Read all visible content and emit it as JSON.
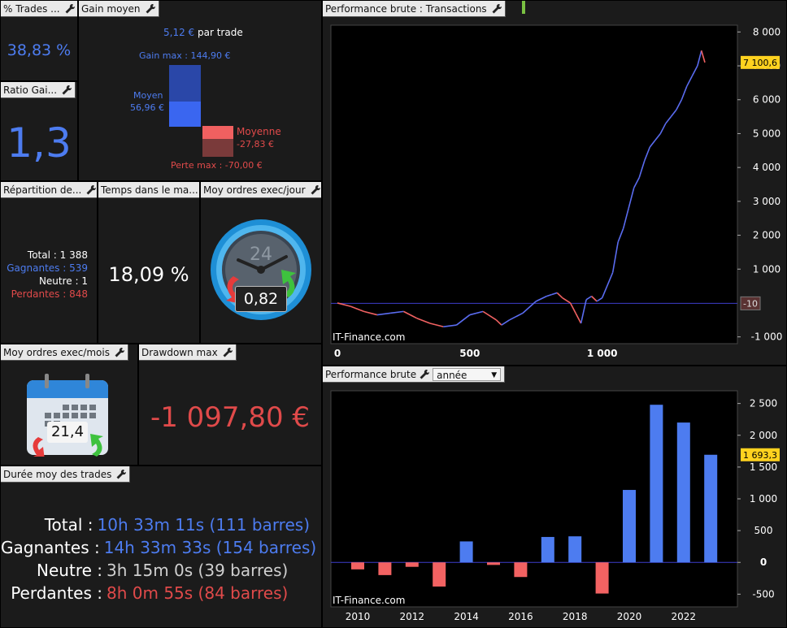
{
  "pct_trades": {
    "title": "% Trades ...",
    "value": "38,83 %"
  },
  "gain_moyen": {
    "title": "Gain moyen",
    "per_trade": "5,12 €",
    "per_trade_suffix": "par trade",
    "gain_max": "Gain max : 144,90 €",
    "moyen_label": "Moyen",
    "moyen_value": "56,96 €",
    "moyenne_label": "Moyenne",
    "moyenne_value": "-27,83 €",
    "perte_max": "Perte max : -70,00 €"
  },
  "ratio": {
    "title": "Ratio Gai...",
    "value": "1,3"
  },
  "repartition": {
    "title": "Répartition de...",
    "total_label": "Total :",
    "total_value": "1 388",
    "gagnantes_label": "Gagnantes :",
    "gagnantes_value": "539",
    "neutre_label": "Neutre :",
    "neutre_value": "1",
    "perdantes_label": "Perdantes :",
    "perdantes_value": "848"
  },
  "temps": {
    "title": "Temps dans le ma...",
    "value": "18,09 %"
  },
  "moy_jour": {
    "title": "Moy ordres exec/jour",
    "dial_number": "24",
    "value": "0,82"
  },
  "moy_mois": {
    "title": "Moy ordres exec/mois",
    "value": "21,4"
  },
  "drawdown": {
    "title": "Drawdown max",
    "value": "-1 097,80 €"
  },
  "duree": {
    "title": "Durée moy des trades",
    "rows": [
      {
        "label": "Total :",
        "value": "10h 33m 11s (111 barres)",
        "color": "#4d7cf0"
      },
      {
        "label": "Gagnantes :",
        "value": "14h 33m 33s (154 barres)",
        "color": "#4d7cf0"
      },
      {
        "label": "Neutre :",
        "value": "3h 15m 0s (39 barres)",
        "color": "#cfcfcf"
      },
      {
        "label": "Perdantes :",
        "value": "8h 0m 55s (84 barres)",
        "color": "#e04a4a"
      }
    ]
  },
  "perf_trans": {
    "title": "Performance brute : Transactions",
    "watermark": "IT-Finance.com",
    "last_value_label": "7 100,6",
    "zero_line_label": "-10"
  },
  "perf_annee": {
    "title": "Performance brute",
    "dropdown": "année",
    "watermark": "IT-Finance.com",
    "last_value_label": "1 693,3"
  },
  "colors": {
    "blue": "#4d7cf0",
    "red": "#f26262",
    "bg": "#1b1b1b",
    "title_bg": "#e9e9e9",
    "highlight": "#ffd21f"
  },
  "chart_data": [
    {
      "type": "line",
      "title": "Performance brute : Transactions",
      "x_ticks": [
        "0",
        "500",
        "1 000"
      ],
      "y_ticks": [
        "8 000",
        "7 000",
        "6 000",
        "5 000",
        "4 000",
        "3 000",
        "2 000",
        "1 000",
        "-1 000"
      ],
      "xlim": [
        0,
        1388
      ],
      "ylim": [
        -1200,
        8200
      ],
      "x": [
        0,
        50,
        100,
        150,
        200,
        250,
        300,
        350,
        400,
        450,
        500,
        550,
        600,
        620,
        650,
        700,
        750,
        790,
        810,
        830,
        850,
        880,
        900,
        920,
        940,
        960,
        980,
        1000,
        1040,
        1060,
        1080,
        1100,
        1120,
        1140,
        1160,
        1180,
        1200,
        1220,
        1240,
        1260,
        1280,
        1300,
        1320,
        1340,
        1360,
        1375,
        1388
      ],
      "y": [
        0,
        -100,
        -250,
        -350,
        -300,
        -250,
        -450,
        -600,
        -700,
        -650,
        -350,
        -250,
        -500,
        -650,
        -500,
        -300,
        50,
        200,
        250,
        300,
        150,
        0,
        -300,
        -600,
        100,
        200,
        50,
        150,
        900,
        1800,
        2200,
        2800,
        3400,
        3700,
        4200,
        4600,
        4800,
        5000,
        5300,
        5500,
        5700,
        6000,
        6400,
        6700,
        7000,
        7450,
        7100
      ],
      "last_value": 7100.6,
      "reference_line": -10,
      "grid": false,
      "colors": {
        "up": "#5a6cf0",
        "down": "#f26262"
      }
    },
    {
      "type": "bar",
      "title": "Performance brute",
      "categories": [
        "2010",
        "2011",
        "2012",
        "2013",
        "2014",
        "2015",
        "2016",
        "2017",
        "2018",
        "2019",
        "2020",
        "2021",
        "2022",
        "2023"
      ],
      "x_tick_labels": [
        "2010",
        "2012",
        "2014",
        "2016",
        "2018",
        "2020",
        "2022"
      ],
      "values": [
        -110,
        -200,
        -70,
        -380,
        330,
        -40,
        -230,
        400,
        410,
        -490,
        1140,
        2480,
        2200,
        1693.3
      ],
      "y_ticks": [
        "2 500",
        "2 000",
        "1 500",
        "1 000",
        "500",
        "0",
        "-500"
      ],
      "ylim": [
        -700,
        2700
      ],
      "last_value": 1693.3,
      "grid": false,
      "colors": {
        "positive": "#4d7cf0",
        "negative": "#f26262"
      }
    }
  ]
}
